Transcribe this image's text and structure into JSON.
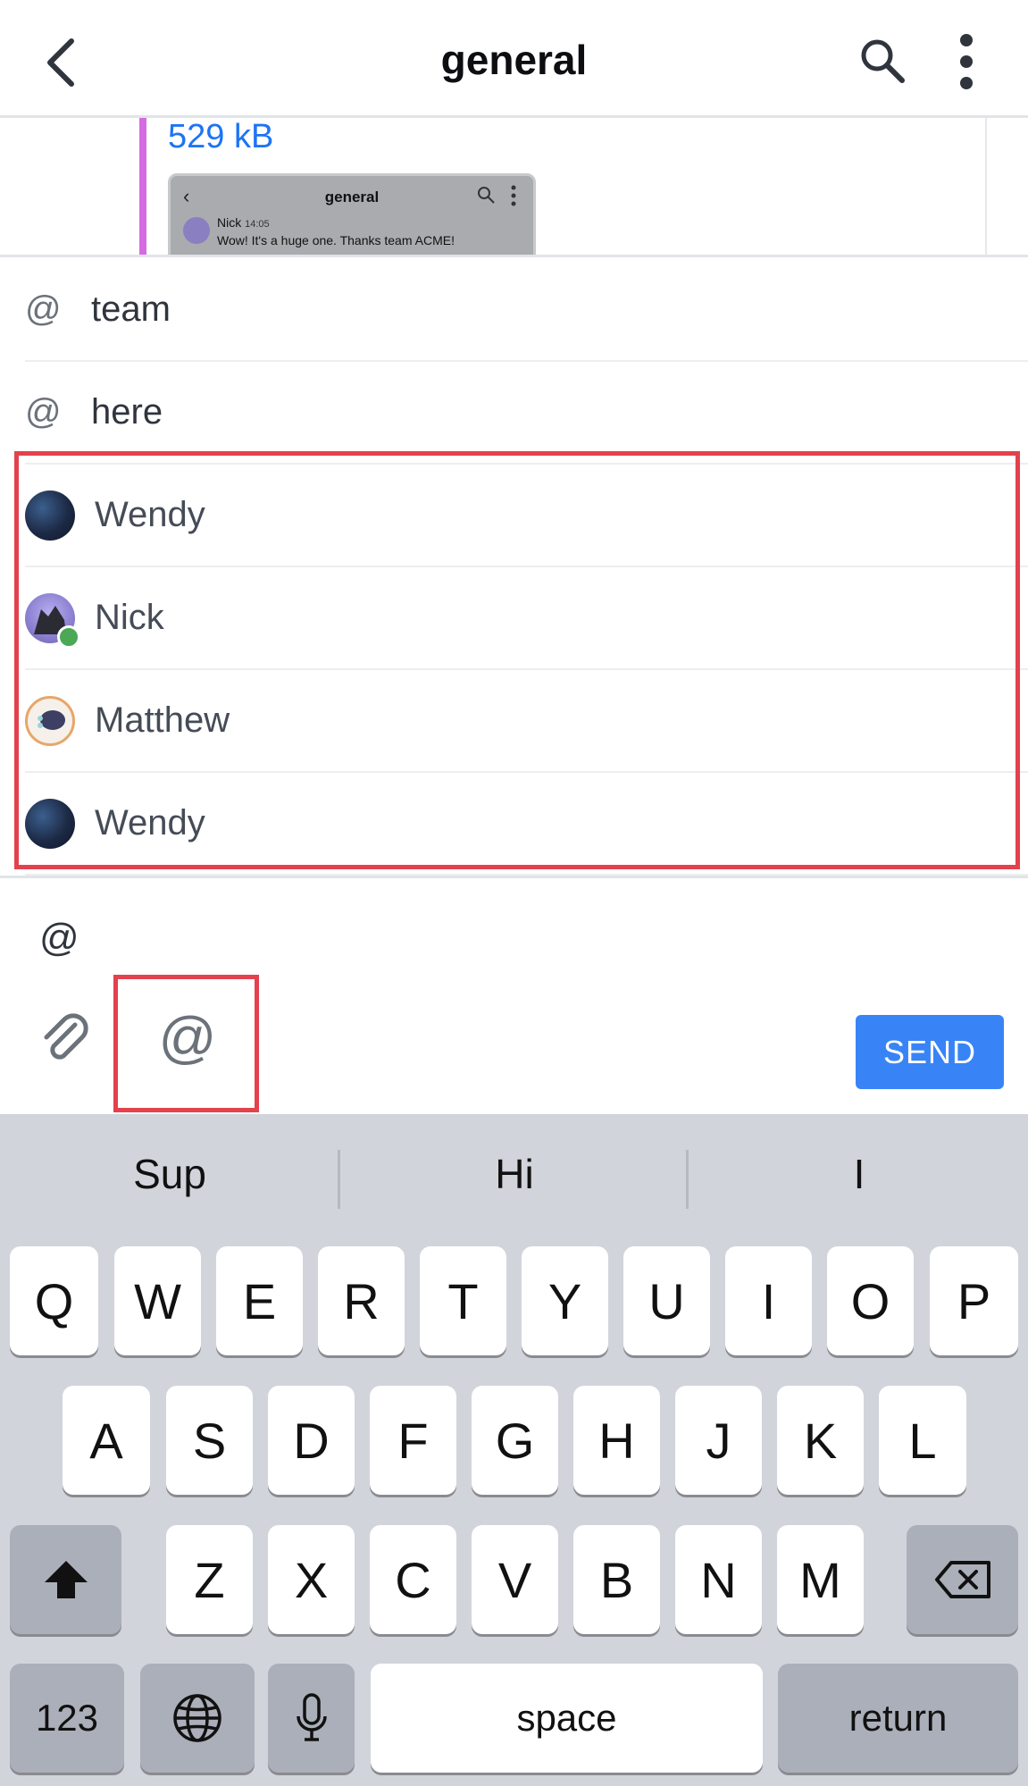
{
  "header": {
    "title": "general"
  },
  "message": {
    "file_size": "529 kB",
    "preview": {
      "title": "general",
      "author": "Nick",
      "time": "14:05",
      "text": "Wow! It's a huge one. Thanks team ACME!"
    }
  },
  "mentions": {
    "at_symbol": "@",
    "channels": [
      {
        "label": "team"
      },
      {
        "label": "here"
      }
    ],
    "users": [
      {
        "label": "Wendy",
        "status": "none"
      },
      {
        "label": "Nick",
        "status": "online"
      },
      {
        "label": "Matthew",
        "status": "none"
      },
      {
        "label": "Wendy",
        "status": "none"
      }
    ]
  },
  "composer": {
    "input_value": "@",
    "mention_button": "@",
    "send_label": "SEND"
  },
  "keyboard": {
    "suggestions": [
      "Sup",
      "Hi",
      "I"
    ],
    "row1": [
      "Q",
      "W",
      "E",
      "R",
      "T",
      "Y",
      "U",
      "I",
      "O",
      "P"
    ],
    "row2": [
      "A",
      "S",
      "D",
      "F",
      "G",
      "H",
      "J",
      "K",
      "L"
    ],
    "row3": [
      "Z",
      "X",
      "C",
      "V",
      "B",
      "N",
      "M"
    ],
    "numbers_label": "123",
    "space_label": "space",
    "return_label": "return"
  },
  "colors": {
    "accent": "#1d74f5",
    "highlight": "#e3414d",
    "online": "#4aa856"
  }
}
